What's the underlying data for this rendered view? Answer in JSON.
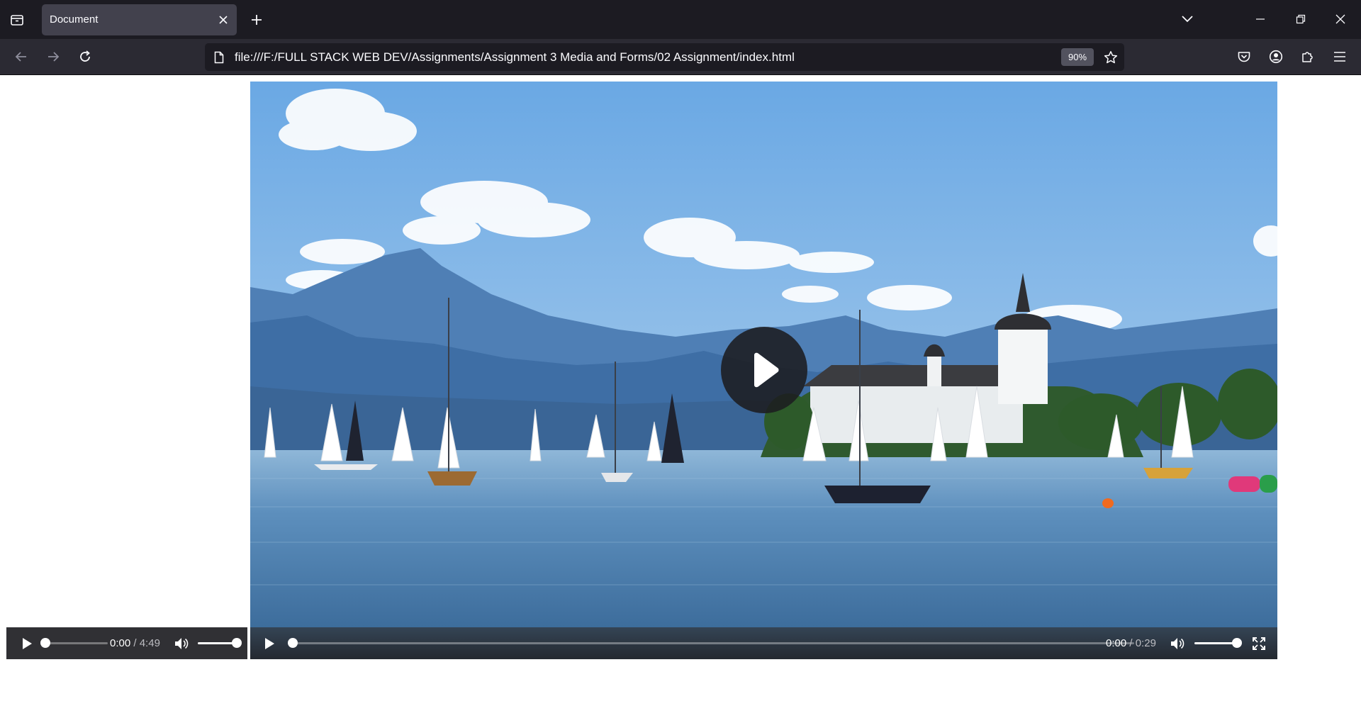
{
  "browser": {
    "tab": {
      "title": "Document"
    },
    "url": "file:///F:/FULL STACK WEB DEV/Assignments/Assignment 3 Media and Forms/02 Assignment/index.html",
    "zoom": "90%",
    "icons": {
      "tab_list": "tab-list-icon",
      "close_tab": "close-icon",
      "new_tab": "plus-icon",
      "list_all_tabs": "chevron-down-icon",
      "minimize": "minimize-icon",
      "restore": "restore-icon",
      "close_window": "close-icon",
      "back": "arrow-left-icon",
      "forward": "arrow-right-icon",
      "reload": "reload-icon",
      "page": "page-icon",
      "bookmark": "star-icon",
      "pocket": "pocket-icon",
      "account": "account-icon",
      "extensions": "puzzle-icon",
      "menu": "hamburger-icon"
    }
  },
  "audio_player": {
    "current_time": "0:00",
    "separator": "/",
    "duration": "4:49",
    "progress": 0.0,
    "volume": 1.0
  },
  "video_player": {
    "current_time": "0:00",
    "separator": "/",
    "duration": "0:29",
    "progress": 0.0,
    "volume": 1.0,
    "poster_scene": "lake with sailboats, mountains and a castle"
  },
  "colors": {
    "chrome_dark": "#1c1b22",
    "toolbar": "#2b2a33",
    "tab_active": "#42414d",
    "controls_bg": "#303034",
    "sky": "#7fb4e6",
    "lake": "#4a7aa8"
  }
}
